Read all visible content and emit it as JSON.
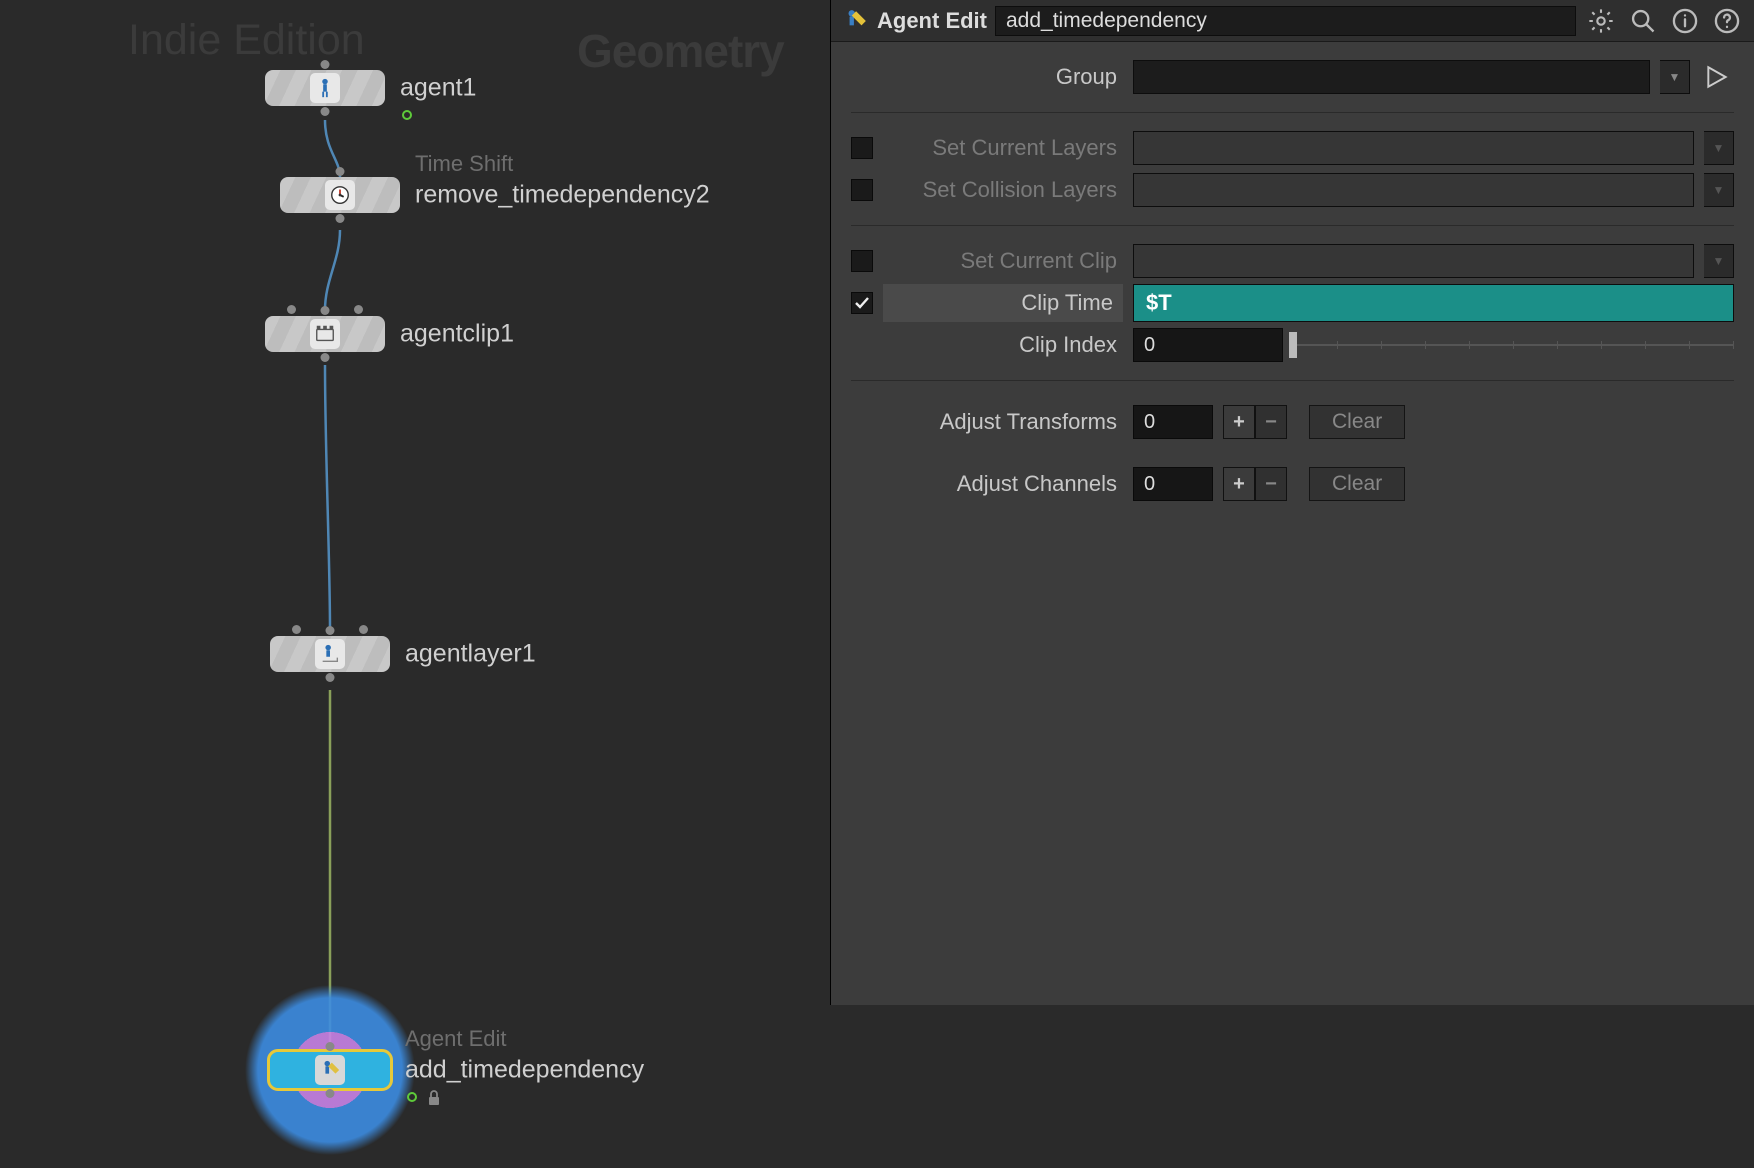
{
  "network": {
    "watermark_indie": "Indie Edition",
    "watermark_geo": "Geometry",
    "nodes": {
      "agent1": {
        "label": "agent1"
      },
      "timeshift": {
        "overlabel": "Time Shift",
        "label": "remove_timedependency2"
      },
      "agentclip1": {
        "label": "agentclip1"
      },
      "agentlayer1": {
        "label": "agentlayer1"
      },
      "agentedit": {
        "overlabel": "Agent Edit",
        "label": "add_timedependency"
      }
    }
  },
  "panel": {
    "op_type": "Agent Edit",
    "op_name": "add_timedependency",
    "group": {
      "label": "Group",
      "value": ""
    },
    "set_current_layers": {
      "label": "Set Current Layers",
      "checked": false
    },
    "set_collision_layers": {
      "label": "Set Collision Layers",
      "checked": false
    },
    "set_current_clip": {
      "label": "Set Current Clip",
      "checked": false
    },
    "clip_time": {
      "label": "Clip Time",
      "checked": true,
      "value": "$T"
    },
    "clip_index": {
      "label": "Clip Index",
      "value": "0"
    },
    "adjust_transforms": {
      "label": "Adjust Transforms",
      "value": "0",
      "clear": "Clear"
    },
    "adjust_channels": {
      "label": "Adjust Channels",
      "value": "0",
      "clear": "Clear"
    }
  }
}
